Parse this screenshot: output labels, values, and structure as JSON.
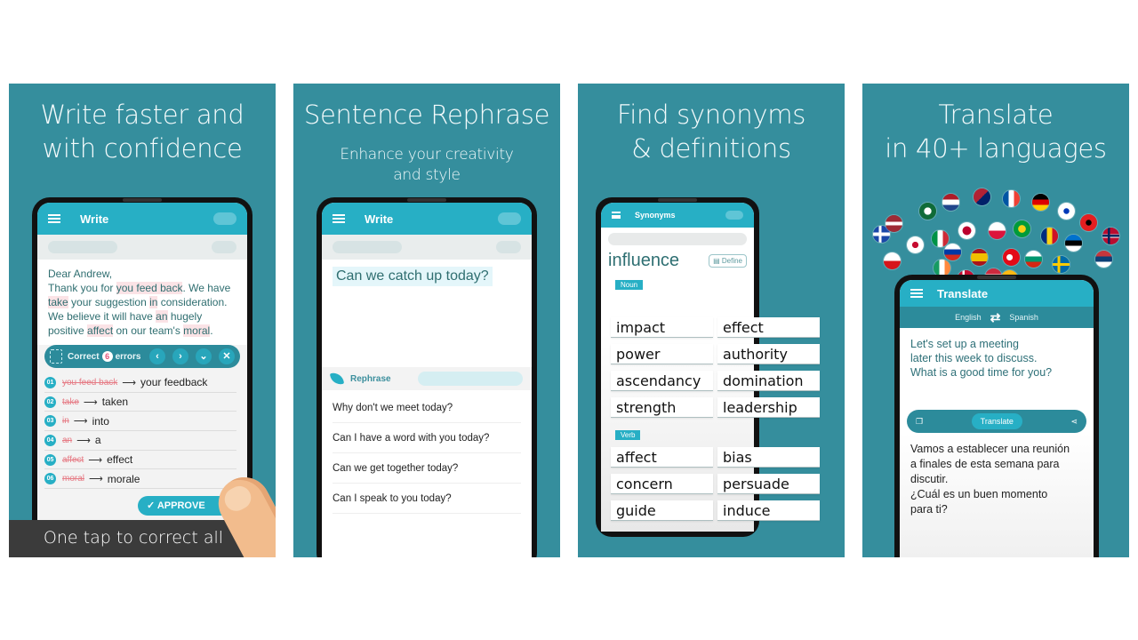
{
  "theme": {
    "panel_bg": "#358e9d",
    "accent": "#27afc5",
    "error_color": "#e67b85",
    "caption_bg": "#3b3b3b"
  },
  "panels": [
    {
      "headline": [
        "Write faster and",
        "with confidence"
      ],
      "app_bar_title": "Write",
      "document": {
        "greeting": "Dear Andrew,",
        "segments": [
          {
            "t": "Thank you for ",
            "err": false
          },
          {
            "t": "you feed back",
            "err": true
          },
          {
            "t": ". We have ",
            "err": false
          },
          {
            "t": "take",
            "err": true
          },
          {
            "t": " your suggestion ",
            "err": false
          },
          {
            "t": "in",
            "err": true
          },
          {
            "t": " consideration. We believe it will have ",
            "err": false
          },
          {
            "t": "an",
            "err": true
          },
          {
            "t": " hugely positive ",
            "err": false
          },
          {
            "t": "affect",
            "err": true
          },
          {
            "t": " on our team's ",
            "err": false
          },
          {
            "t": "moral",
            "err": true
          },
          {
            "t": ".",
            "err": false
          }
        ]
      },
      "correct_bar": {
        "prefix": "Correct",
        "count": "6",
        "suffix": "errors",
        "prev": "‹",
        "next": "›",
        "expand": "⌄",
        "close": "✕"
      },
      "corrections": [
        {
          "num": "01",
          "wrong": "you feed back",
          "right": "your feedback"
        },
        {
          "num": "02",
          "wrong": "take",
          "right": "taken"
        },
        {
          "num": "03",
          "wrong": "in",
          "right": "into"
        },
        {
          "num": "04",
          "wrong": "an",
          "right": "a"
        },
        {
          "num": "05",
          "wrong": "affect",
          "right": "effect"
        },
        {
          "num": "06",
          "wrong": "moral",
          "right": "morale"
        }
      ],
      "arrow": "⟶",
      "approve_label": "✓ APPROVE ALL",
      "caption": "One tap to correct all"
    },
    {
      "headline": [
        "Sentence Rephrase"
      ],
      "subheadline": [
        "Enhance your creativity",
        "and style"
      ],
      "app_bar_title": "Write",
      "input_sentence": "Can we catch up today?",
      "rephrase_label": "Rephrase",
      "suggestions": [
        "Why don't we meet today?",
        "Can I have a word with you today?",
        "Can we get together today?",
        "Can I speak to you today?"
      ]
    },
    {
      "headline": [
        "Find synonyms",
        "& definitions"
      ],
      "app_bar_title": "Synonyms",
      "word": "influence",
      "define_label": "Define",
      "groups": [
        {
          "pos": "Noun",
          "synonyms": [
            "impact",
            "effect",
            "power",
            "authority",
            "ascendancy",
            "domination",
            "strength",
            "leadership"
          ]
        },
        {
          "pos": "Verb",
          "synonyms": [
            "affect",
            "bias",
            "concern",
            "persuade",
            "guide",
            "induce"
          ]
        }
      ]
    },
    {
      "headline": [
        "Translate",
        "in 40+ languages"
      ],
      "app_bar_title": "Translate",
      "source_lang": "English",
      "target_lang": "Spanish",
      "source_text": [
        "Let's set up a meeting",
        "later this week to discuss.",
        "What is a good time for you?"
      ],
      "translate_label": "Translate",
      "translated_text": [
        "Vamos a establecer una reunión",
        "a finales de esta semana para",
        "discutir.",
        "¿Cuál es un buen momento",
        "para ti?"
      ],
      "flags": [
        "Iceland",
        "Latvia",
        "Czechia",
        "South Korea",
        "Arabic League",
        "Netherlands",
        "Italy",
        "Ireland",
        "Japan",
        "Russia",
        "UK/US",
        "France",
        "Poland",
        "Spain",
        "Denmark",
        "Hungary",
        "Brazil",
        "Turkey",
        "Lithuania",
        "Germany",
        "Romania",
        "Bulgaria",
        "Sweden",
        "Israel",
        "Estonia",
        "Albania",
        "Serbia",
        "Norway"
      ]
    }
  ]
}
